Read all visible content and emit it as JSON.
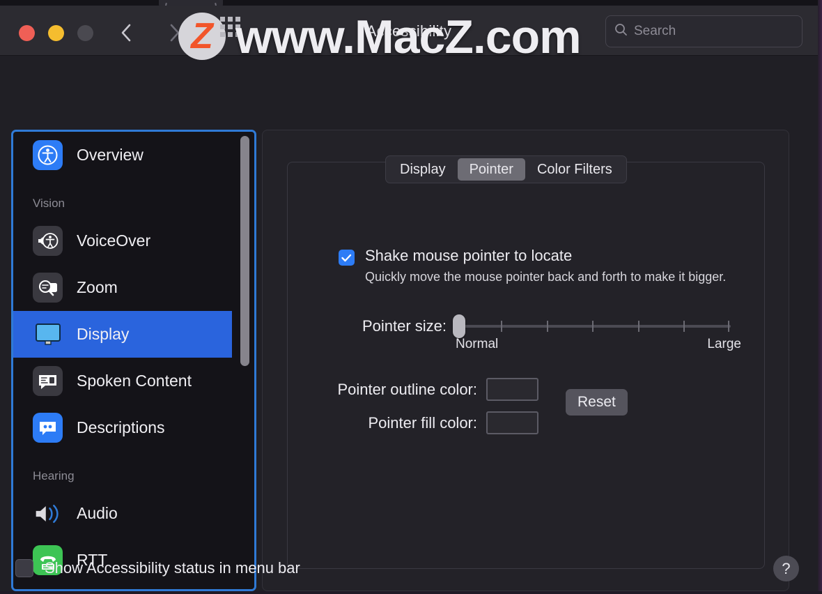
{
  "window": {
    "title": "Accessibility",
    "traffic_lights": [
      "close-red",
      "minimize-yellow",
      "zoom-disabled-gray"
    ],
    "nav": {
      "back_icon": "chevron-left-icon",
      "forward_icon": "chevron-right-icon"
    },
    "search": {
      "placeholder": "Search",
      "value": "",
      "icon": "search-icon"
    }
  },
  "sidebar": {
    "items": [
      {
        "label": "Overview",
        "icon": "accessibility-person-icon",
        "icon_style": "blue",
        "selected": false
      },
      {
        "group": "Vision"
      },
      {
        "label": "VoiceOver",
        "icon": "voiceover-icon",
        "icon_style": "dark",
        "selected": false
      },
      {
        "label": "Zoom",
        "icon": "zoom-magnifier-icon",
        "icon_style": "dark",
        "selected": false
      },
      {
        "label": "Display",
        "icon": "display-monitor-icon",
        "icon_style": "plain",
        "selected": true
      },
      {
        "label": "Spoken Content",
        "icon": "speech-bubble-icon",
        "icon_style": "dark",
        "selected": false
      },
      {
        "label": "Descriptions",
        "icon": "descriptions-bubble-icon",
        "icon_style": "blue",
        "selected": false
      },
      {
        "group": "Hearing"
      },
      {
        "label": "Audio",
        "icon": "speaker-icon",
        "icon_style": "plain",
        "selected": false
      },
      {
        "label": "RTT",
        "icon": "phone-rtt-icon",
        "icon_style": "green",
        "selected": false
      }
    ],
    "scrollbar": "vertical-scrollbar"
  },
  "main": {
    "tabs": [
      {
        "label": "Display",
        "active": false
      },
      {
        "label": "Pointer",
        "active": true
      },
      {
        "label": "Color Filters",
        "active": false
      }
    ],
    "shake_checkbox": {
      "label": "Shake mouse pointer to locate",
      "checked": true,
      "description": "Quickly move the mouse pointer back and forth to make it bigger."
    },
    "pointer_size": {
      "label": "Pointer size:",
      "min_label": "Normal",
      "max_label": "Large",
      "value": 0,
      "ticks": 6
    },
    "outline_color": {
      "label": "Pointer outline color:",
      "value": "#FFFFFF"
    },
    "fill_color": {
      "label": "Pointer fill color:",
      "value": "#E8C11E"
    },
    "reset_button": "Reset"
  },
  "footer": {
    "menu_bar_checkbox": {
      "label": "Show Accessibility status in menu bar",
      "checked": false
    },
    "help_button": "?"
  },
  "watermark": {
    "text": "www.MacZ.com",
    "logo_letter": "Z"
  },
  "colors": {
    "accent_blue": "#2A64DD",
    "focus_ring": "#2F7AD6",
    "window_bg": "#201F25",
    "titlebar_bg": "#2C2B31",
    "sidebar_bg": "#141318",
    "pointer_fill": "#E8C11E",
    "pointer_outline": "#FFFFFF"
  }
}
